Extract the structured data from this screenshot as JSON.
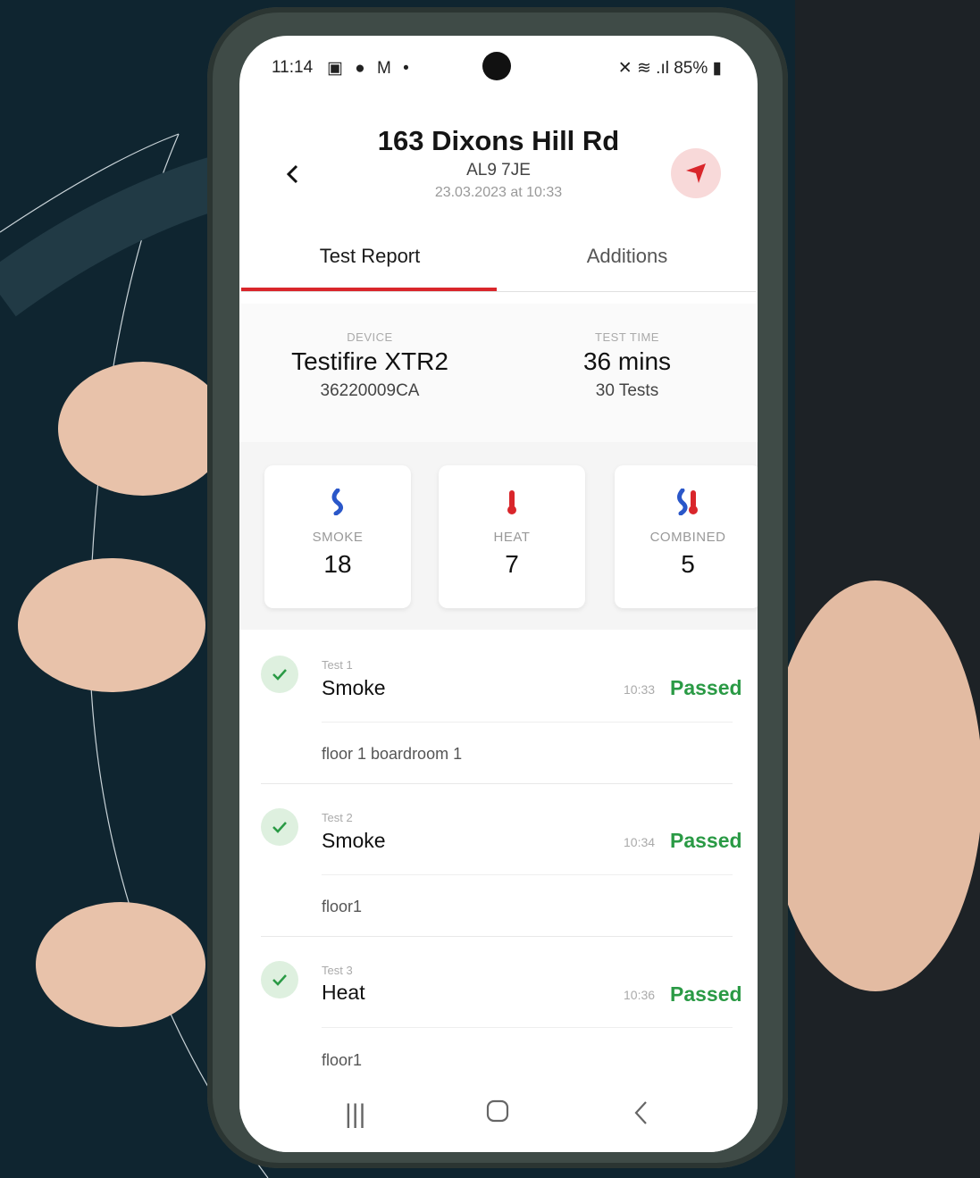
{
  "status_bar": {
    "time": "11:14",
    "icons": "▣ ● M •",
    "right": "✕ ≋ .ıl 85% ▮"
  },
  "header": {
    "title": "163 Dixons Hill Rd",
    "postcode": "AL9 7JE",
    "datetime": "23.03.2023 at 10:33"
  },
  "tabs": [
    {
      "label": "Test Report"
    },
    {
      "label": "Additions"
    }
  ],
  "device": {
    "label": "DEVICE",
    "name": "Testifire XTR2",
    "serial": "36220009CA"
  },
  "test_time": {
    "label": "TEST TIME",
    "value": "36 mins",
    "tests": "30 Tests"
  },
  "cards": [
    {
      "label": "SMOKE",
      "value": "18",
      "icon": "smoke-icon"
    },
    {
      "label": "HEAT",
      "value": "7",
      "icon": "heat-icon"
    },
    {
      "label": "COMBINED",
      "value": "5",
      "icon": "combined-icon"
    }
  ],
  "tests": [
    {
      "label": "Test 1",
      "type": "Smoke",
      "time": "10:33",
      "status": "Passed",
      "location": "floor 1 boardroom 1"
    },
    {
      "label": "Test 2",
      "type": "Smoke",
      "time": "10:34",
      "status": "Passed",
      "location": "floor1"
    },
    {
      "label": "Test 3",
      "type": "Heat",
      "time": "10:36",
      "status": "Passed",
      "location": "floor1"
    }
  ],
  "colors": {
    "accent": "#d9262b",
    "passed": "#2a9a45"
  }
}
